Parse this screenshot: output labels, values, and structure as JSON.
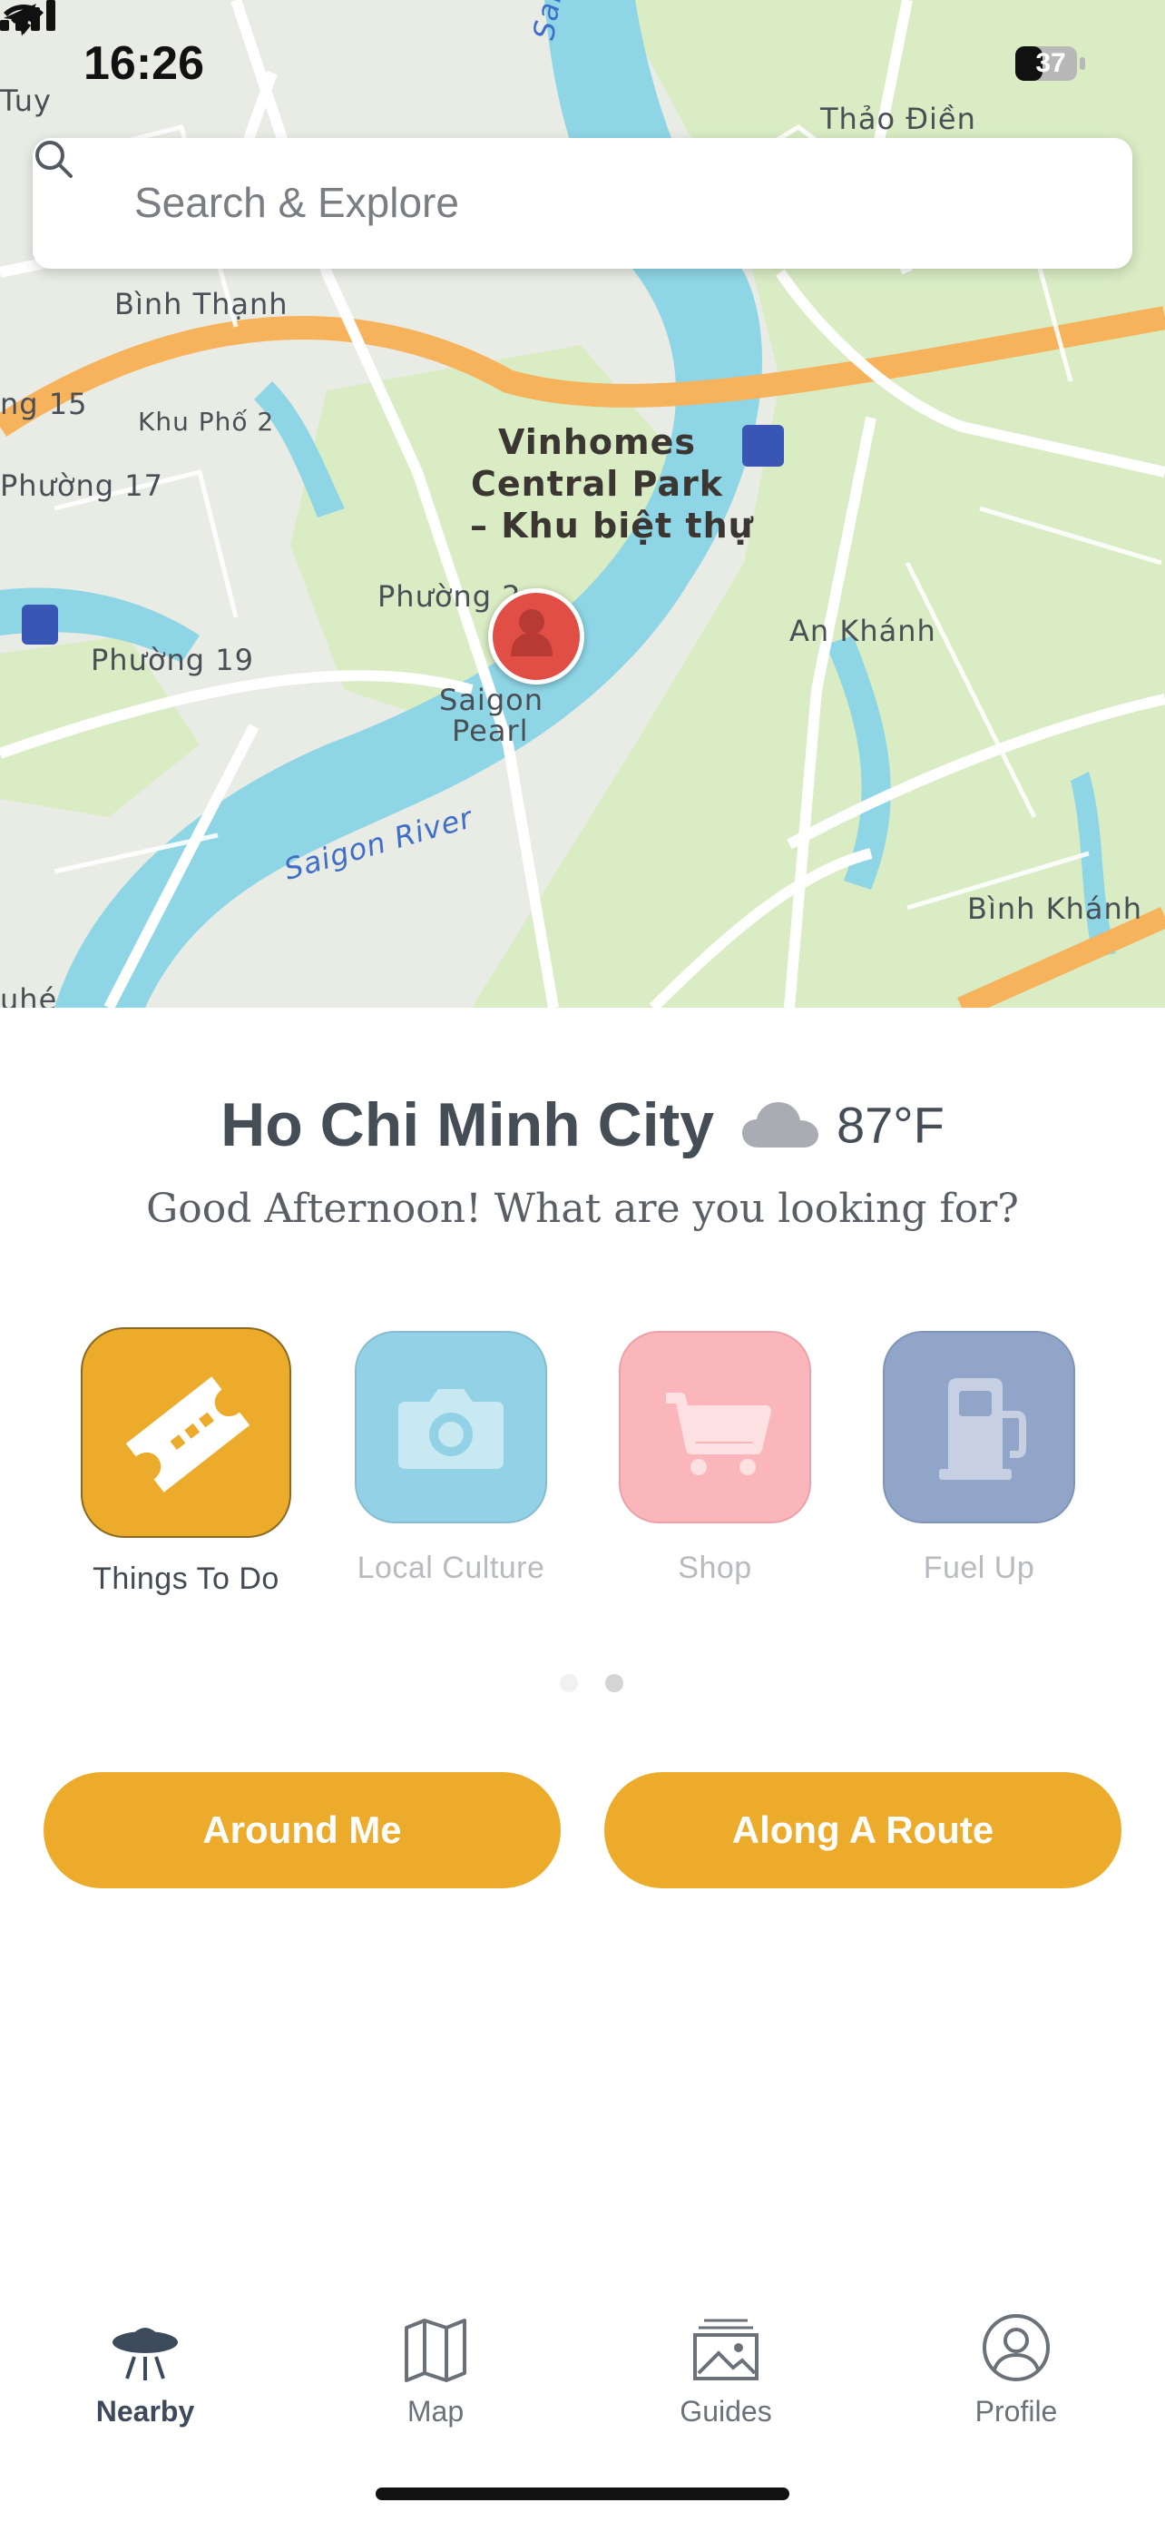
{
  "status_bar": {
    "time": "16:26",
    "battery": "37"
  },
  "search": {
    "placeholder": "Search & Explore"
  },
  "map": {
    "labels": {
      "thao_dien": "Thảo Điền",
      "binh_thanh": "Bình Thạnh",
      "phuong_15": "ng 15",
      "khu_pho_2": "Khu Phố 2",
      "phuong_17": "Phường 17",
      "vinhomes": "Vinhomes",
      "central_park": "Central Park",
      "khu_biet_thu": "– Khu biệt thự",
      "phuong_22": "Phường 2",
      "an_khanh": "An Khánh",
      "phuong_19": "Phường 19",
      "saigon_pearl_1": "Saigon",
      "saigon_pearl_2": "Pearl",
      "saigon_river": "Saigon River",
      "saigon_river_top": "Saigon R",
      "binh_khanh": "Bình Khánh",
      "tuy": "Tuy",
      "uhe": "uhé"
    }
  },
  "location": {
    "city": "Ho Chi Minh City",
    "temperature": "87°F",
    "greeting": "Good Afternoon! What are you looking for?"
  },
  "categories": [
    {
      "label": "Things To Do",
      "icon": "ticket-icon",
      "color": "#ecab2b",
      "active": true
    },
    {
      "label": "Local Culture",
      "icon": "camera-icon",
      "color": "#93d2e6",
      "active": false
    },
    {
      "label": "Shop",
      "icon": "shopping-cart-icon",
      "color": "#fbb6bb",
      "active": false
    },
    {
      "label": "Fuel Up",
      "icon": "fuel-pump-icon",
      "color": "#91a5c9",
      "active": false
    }
  ],
  "pager": {
    "pages": 2,
    "current": 2
  },
  "actions": {
    "around_me": "Around Me",
    "along_route": "Along A Route"
  },
  "tabs": [
    {
      "label": "Nearby",
      "icon": "ufo-icon",
      "active": true
    },
    {
      "label": "Map",
      "icon": "map-icon",
      "active": false
    },
    {
      "label": "Guides",
      "icon": "guides-icon",
      "active": false
    },
    {
      "label": "Profile",
      "icon": "profile-icon",
      "active": false
    }
  ],
  "colors": {
    "accent": "#ecab2b",
    "water": "#8ed6e6",
    "park": "#d9ecc4",
    "road": "#f7b25c"
  }
}
